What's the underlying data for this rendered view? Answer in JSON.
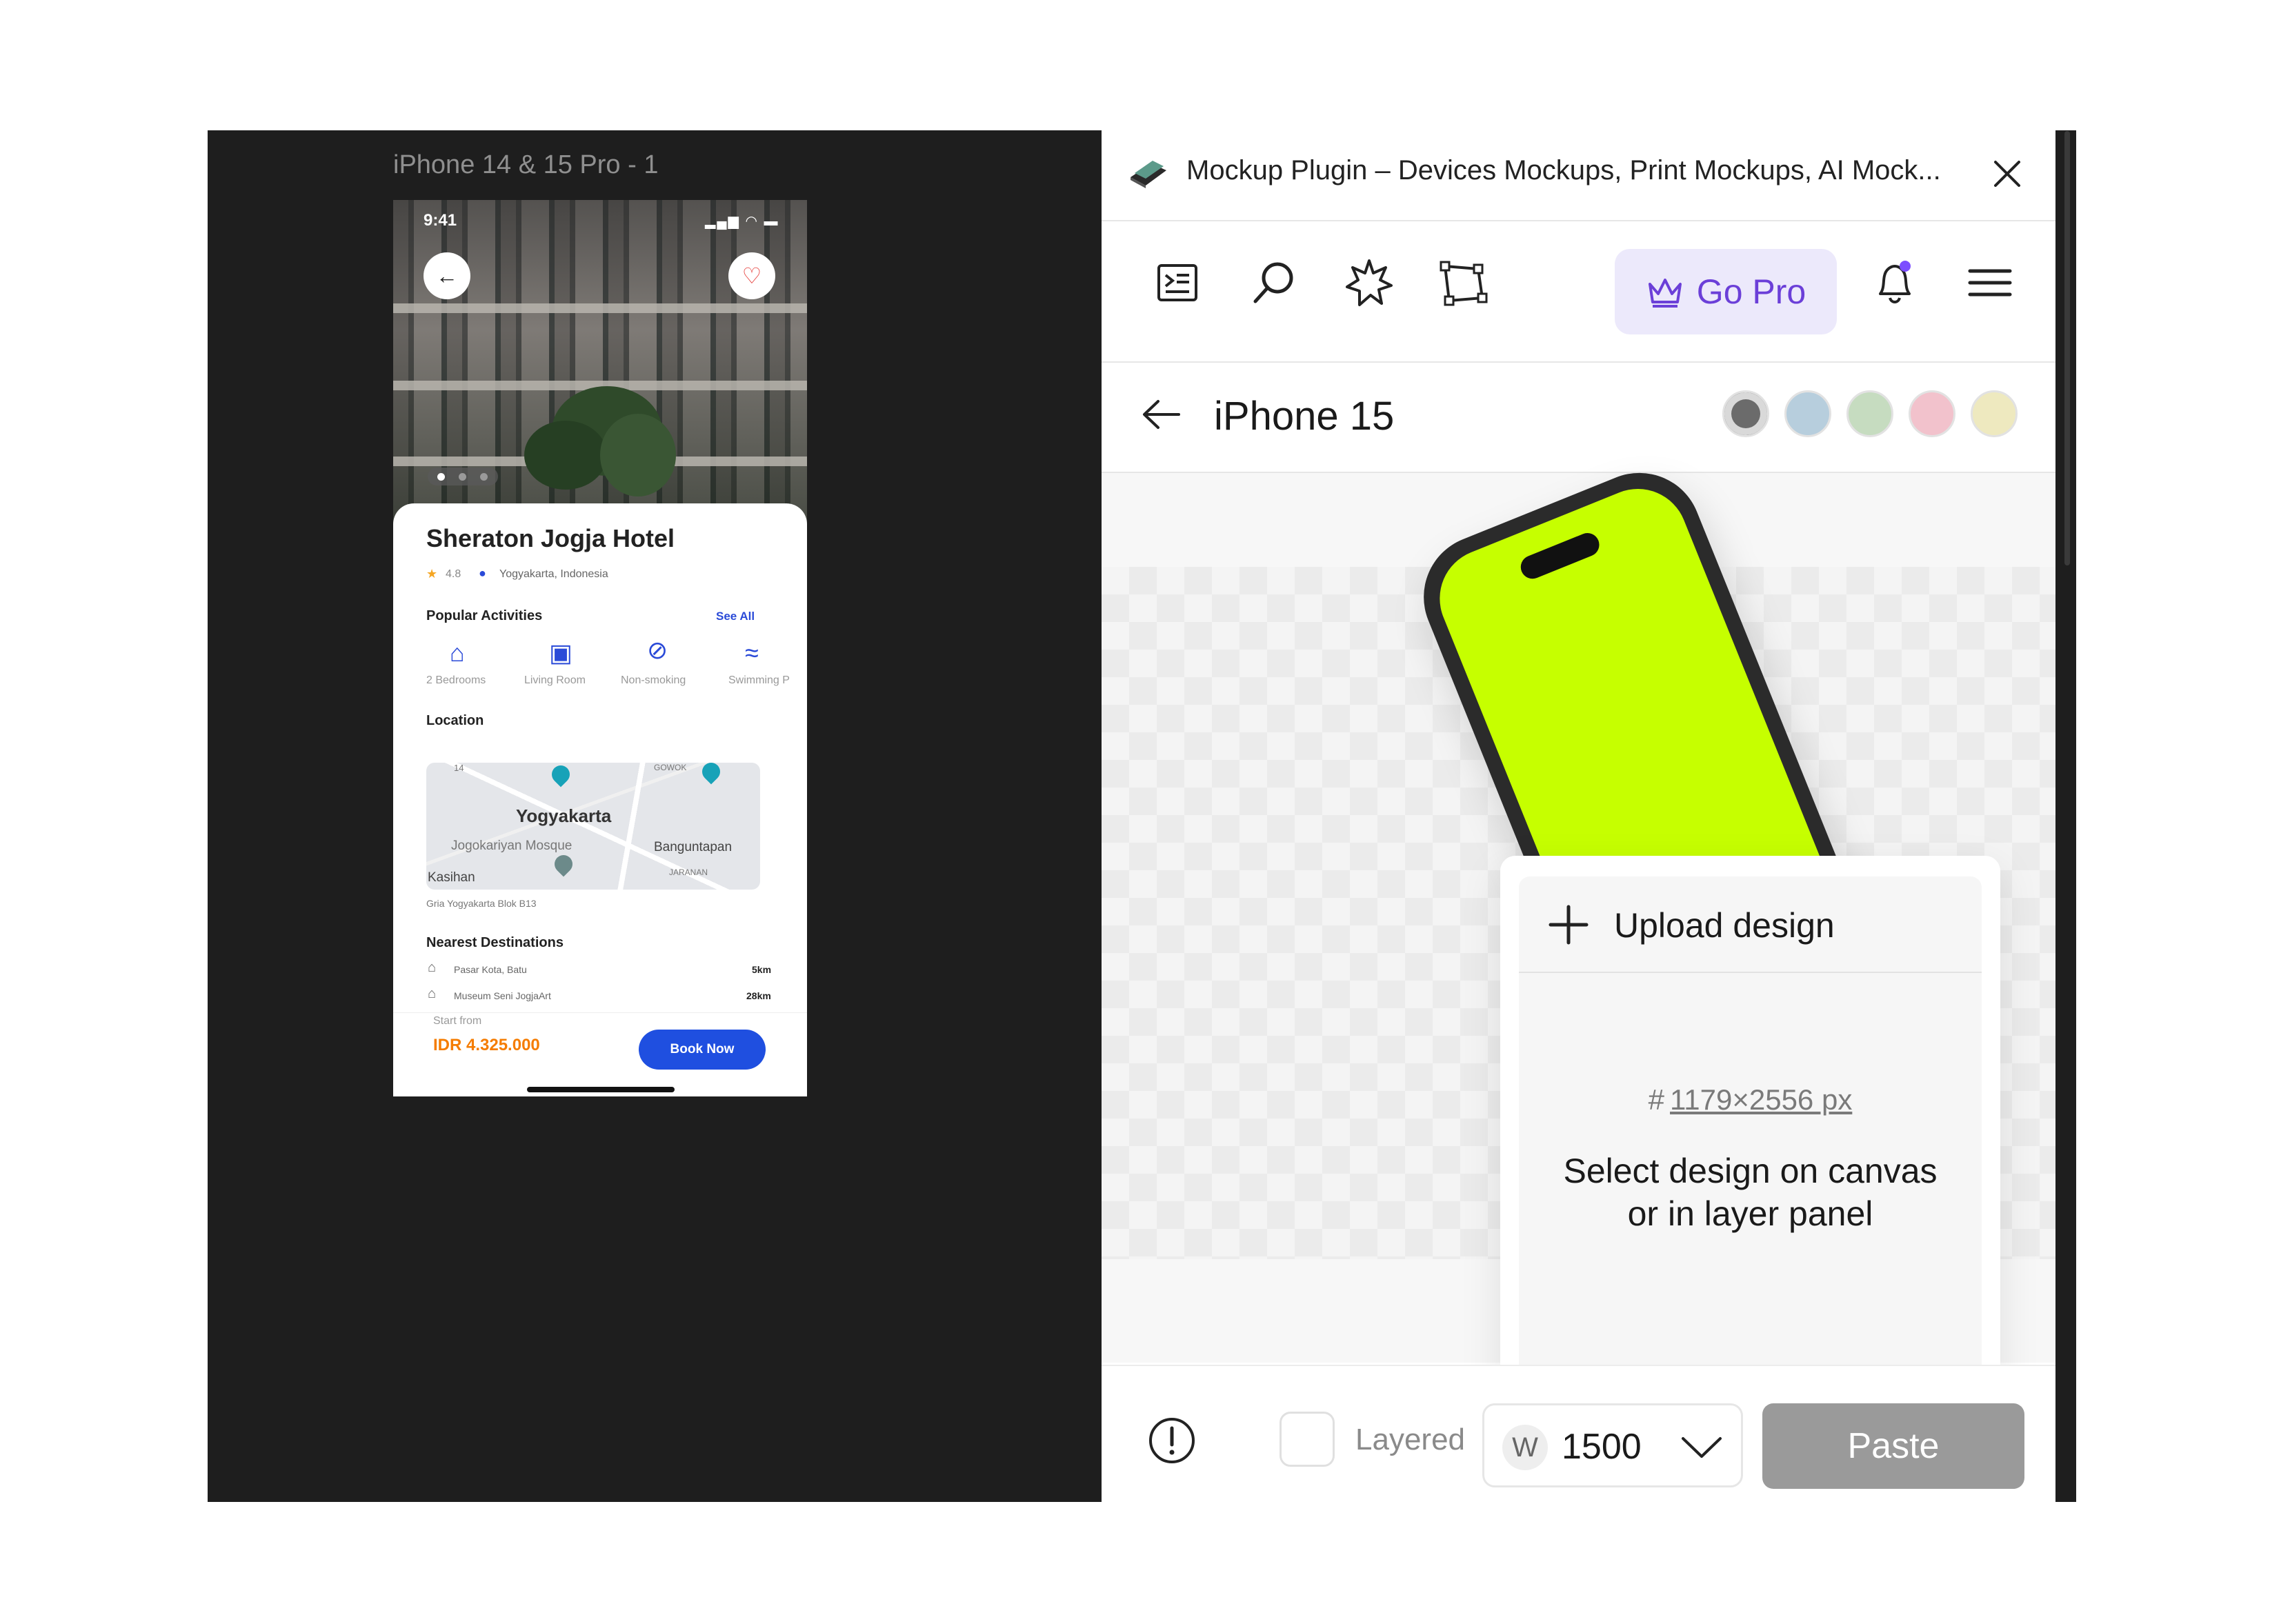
{
  "canvas": {
    "frame_label": "iPhone 14 & 15 Pro - 1",
    "app": {
      "status_time": "9:41",
      "status_icons": "▂▄▆ ◠ ▬",
      "hotel_name": "Sheraton Jogja Hotel",
      "rating": "4.8",
      "location": "Yogyakarta, Indonesia",
      "popular_title": "Popular Activities",
      "see_all": "See All",
      "activities": [
        {
          "label": "2 Bedrooms",
          "icon": "bed-icon"
        },
        {
          "label": "Living Room",
          "icon": "picture-icon"
        },
        {
          "label": "Non-smoking",
          "icon": "no-smoking-icon"
        },
        {
          "label": "Swimming P",
          "icon": "swimming-icon"
        }
      ],
      "location_title": "Location",
      "map_labels": {
        "city": "Yogyakarta",
        "mosque": "Jogokariyan Mosque",
        "banguntapan": "Banguntapan",
        "kasihan": "Kasihan",
        "gowok": "GOWOK",
        "jaranan": "JARANAN",
        "route": "14"
      },
      "address": "Gria Yogyakarta Blok B13",
      "nearest_title": "Nearest Destinations",
      "destinations": [
        {
          "name": "Pasar Kota, Batu",
          "distance": "5km"
        },
        {
          "name": "Museum Seni JogjaArt",
          "distance": "28km"
        }
      ],
      "start_from": "Start from",
      "price": "IDR 4.325.000",
      "book_now": "Book Now"
    }
  },
  "plugin": {
    "title": "Mockup Plugin – Devices Mockups, Print Mockups, AI Mock...",
    "go_pro": "Go Pro",
    "device_name": "iPhone 15",
    "swatches": [
      "#6b6b6b",
      "#b7cedd",
      "#c6dcc0",
      "#f2c2cc",
      "#eee9bf"
    ],
    "upload_label": "Upload design",
    "dimension": "1179×2556 px",
    "select_hint": "Select design on canvas or in layer panel",
    "layered_label": "Layered",
    "width_badge": "W",
    "width_value": "1500",
    "paste_label": "Paste",
    "accent": "#6b3fd8",
    "mock_screen_color": "#c6ff00"
  }
}
